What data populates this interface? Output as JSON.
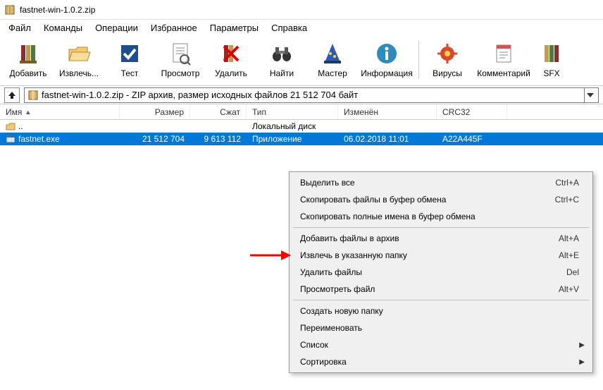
{
  "window": {
    "title": "fastnet-win-1.0.2.zip"
  },
  "menubar": [
    {
      "id": "file",
      "label": "Файл"
    },
    {
      "id": "commands",
      "label": "Команды"
    },
    {
      "id": "operations",
      "label": "Операции"
    },
    {
      "id": "favorites",
      "label": "Избранное"
    },
    {
      "id": "options",
      "label": "Параметры"
    },
    {
      "id": "help",
      "label": "Справка"
    }
  ],
  "toolbar": [
    {
      "id": "add",
      "label": "Добавить"
    },
    {
      "id": "extract",
      "label": "Извлечь..."
    },
    {
      "id": "test",
      "label": "Тест"
    },
    {
      "id": "view",
      "label": "Просмотр"
    },
    {
      "id": "delete",
      "label": "Удалить"
    },
    {
      "id": "find",
      "label": "Найти"
    },
    {
      "id": "wizard",
      "label": "Мастер"
    },
    {
      "id": "info",
      "label": "Информация"
    },
    {
      "id": "virus",
      "label": "Вирусы"
    },
    {
      "id": "comment",
      "label": "Комментарий"
    },
    {
      "id": "sfx",
      "label": "SFX"
    }
  ],
  "pathbar": {
    "text": "fastnet-win-1.0.2.zip - ZIP архив, размер исходных файлов 21 512 704 байт"
  },
  "columns": {
    "name": "Имя",
    "size": "Размер",
    "compressed": "Сжат",
    "type": "Тип",
    "modified": "Изменён",
    "crc": "CRC32"
  },
  "rows": [
    {
      "icon": "folder-up",
      "name": "..",
      "size": "",
      "compressed": "",
      "type": "Локальный диск",
      "modified": "",
      "crc": "",
      "selected": false
    },
    {
      "icon": "exe",
      "name": "fastnet.exe",
      "size": "21 512 704",
      "compressed": "9 613 112",
      "type": "Приложение",
      "modified": "06.02.2018 11:01",
      "crc": "A22A445F",
      "selected": true
    }
  ],
  "context_menu": [
    {
      "type": "item",
      "label": "Выделить все",
      "shortcut": "Ctrl+A"
    },
    {
      "type": "item",
      "label": "Скопировать файлы в буфер обмена",
      "shortcut": "Ctrl+C"
    },
    {
      "type": "item",
      "label": "Скопировать полные имена в буфер обмена",
      "shortcut": ""
    },
    {
      "type": "sep"
    },
    {
      "type": "item",
      "label": "Добавить файлы в архив",
      "shortcut": "Alt+A"
    },
    {
      "type": "item",
      "label": "Извлечь в указанную папку",
      "shortcut": "Alt+E"
    },
    {
      "type": "item",
      "label": "Удалить файлы",
      "shortcut": "Del"
    },
    {
      "type": "item",
      "label": "Просмотреть файл",
      "shortcut": "Alt+V"
    },
    {
      "type": "sep"
    },
    {
      "type": "item",
      "label": "Создать новую папку",
      "shortcut": ""
    },
    {
      "type": "item",
      "label": "Переименовать",
      "shortcut": ""
    },
    {
      "type": "submenu",
      "label": "Список",
      "shortcut": ""
    },
    {
      "type": "submenu",
      "label": "Сортировка",
      "shortcut": ""
    }
  ]
}
